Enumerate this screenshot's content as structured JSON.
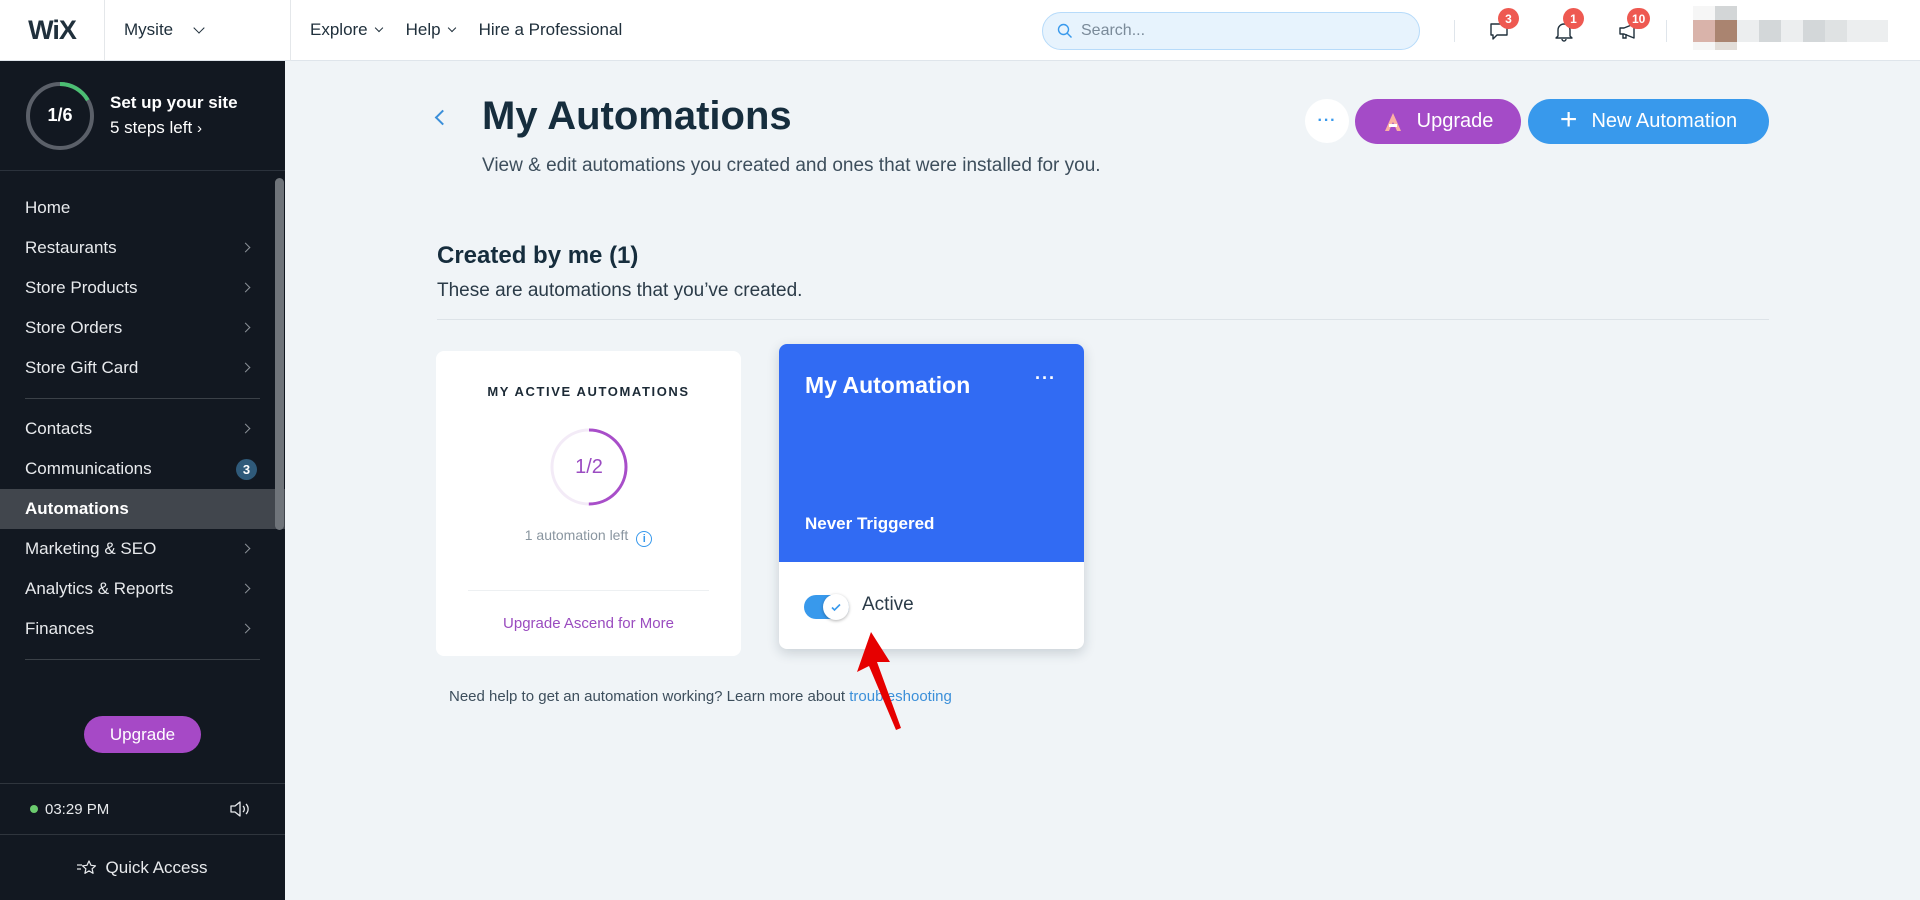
{
  "topbar": {
    "logo": "WiX",
    "site_selector": "Mysite",
    "nav": [
      {
        "label": "Explore",
        "has_dropdown": true
      },
      {
        "label": "Help",
        "has_dropdown": true
      },
      {
        "label": "Hire a Professional",
        "has_dropdown": false
      }
    ],
    "search_placeholder": "Search...",
    "icons": [
      {
        "name": "chat-icon",
        "badge": "3"
      },
      {
        "name": "bell-icon",
        "badge": "1"
      },
      {
        "name": "megaphone-icon",
        "badge": "10"
      }
    ]
  },
  "sidebar": {
    "setup": {
      "progress_label": "1/6",
      "progress_fraction": 0.1667,
      "title": "Set up your site",
      "steps_left": "5 steps left"
    },
    "items": [
      {
        "label": "Home",
        "arrow": false
      },
      {
        "label": "Restaurants",
        "arrow": true
      },
      {
        "label": "Store Products",
        "arrow": true
      },
      {
        "label": "Store Orders",
        "arrow": true
      },
      {
        "label": "Store Gift Card",
        "arrow": true
      },
      {
        "label": "Contacts",
        "arrow": true
      },
      {
        "label": "Communications",
        "badge": "3"
      },
      {
        "label": "Automations",
        "active": true
      },
      {
        "label": "Marketing & SEO",
        "arrow": true
      },
      {
        "label": "Analytics & Reports",
        "arrow": true
      },
      {
        "label": "Finances",
        "arrow": true
      }
    ],
    "upgrade_label": "Upgrade",
    "time": "03:29 PM",
    "quick_access": "Quick Access"
  },
  "main": {
    "title": "My Automations",
    "subtitle": "View & edit automations you created and ones that were installed for you.",
    "more_label": "···",
    "upgrade_label": "Upgrade",
    "new_label": "New Automation",
    "section": {
      "title": "Created by me (1)",
      "subtitle": "These are automations that you’ve created."
    },
    "stats": {
      "heading": "MY ACTIVE AUTOMATIONS",
      "progress_label": "1/2",
      "used": 1,
      "total": 2,
      "left_text": "1 automation left",
      "link": "Upgrade Ascend for More"
    },
    "automation": {
      "name": "My Automation",
      "menu": "···",
      "status": "Never Triggered",
      "toggle_on": true,
      "toggle_label": "Active"
    },
    "help_text": "Need help to get an automation working? Learn more about ",
    "help_link": "troubleshooting"
  },
  "colors": {
    "accent_blue": "#3899ec",
    "card_blue": "#316bf3",
    "upgrade_purple": "#a44bc7",
    "sidebar_bg": "#121821",
    "badge_red": "#ee5951",
    "setup_green": "#4bbf73"
  }
}
